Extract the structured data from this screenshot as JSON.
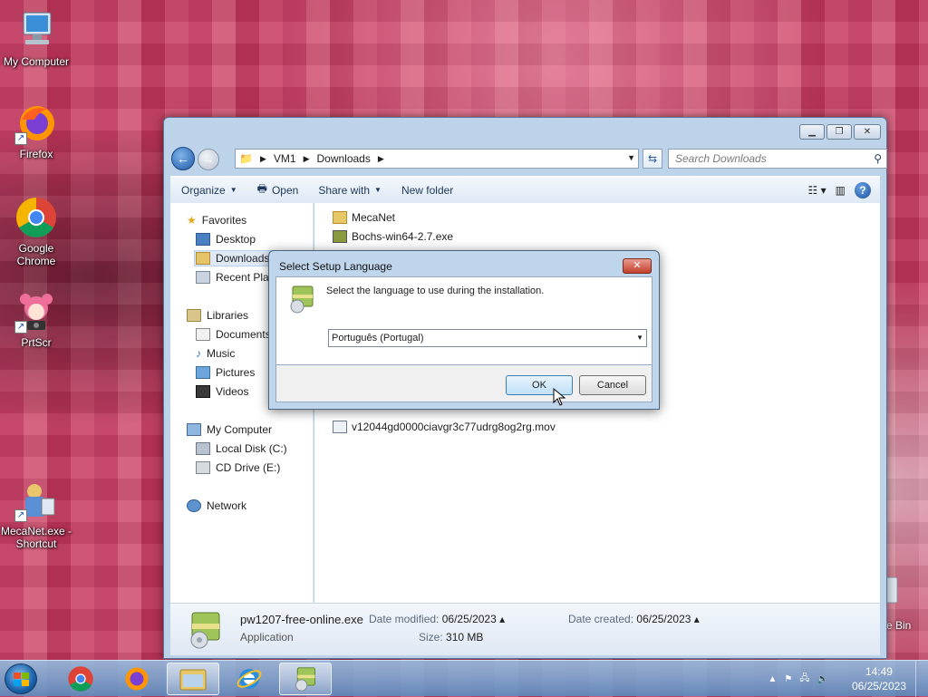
{
  "desktop": {
    "icons": [
      {
        "label": "My Computer"
      },
      {
        "label": "Firefox"
      },
      {
        "label": "Google Chrome"
      },
      {
        "label": "PrtScr"
      },
      {
        "label": "MecaNet.exe - Shortcut"
      }
    ],
    "recycle_partial": "e Bin"
  },
  "explorer": {
    "breadcrumb": [
      "VM1",
      "Downloads"
    ],
    "search_placeholder": "Search Downloads",
    "toolbar": {
      "organize": "Organize",
      "open": "Open",
      "share_with": "Share with",
      "new_folder": "New folder"
    },
    "nav": {
      "favorites": "Favorites",
      "desktop": "Desktop",
      "downloads": "Downloads",
      "recent": "Recent Plac",
      "libraries": "Libraries",
      "documents": "Documents",
      "music": "Music",
      "pictures": "Pictures",
      "videos": "Videos",
      "computer": "My Computer",
      "local_disk": "Local Disk (C:)",
      "cd_drive": "CD Drive (E:)",
      "network": "Network"
    },
    "files": [
      {
        "name": "MecaNet",
        "icon": "folder-icon"
      },
      {
        "name": "Bochs-win64-2.7.exe",
        "icon": "installer-icon"
      },
      {
        "name": "v12044gd0000ciavgr3c77udrg8og2rg.mov",
        "icon": "video-file-icon"
      }
    ],
    "details": {
      "filename": "pw1207-free-online.exe",
      "type": "Application",
      "date_modified_label": "Date modified:",
      "date_modified": "06/25/2023",
      "size_label": "Size:",
      "size": "310 MB",
      "date_created_label": "Date created:",
      "date_created": "06/25/2023"
    }
  },
  "dialog": {
    "title": "Select Setup Language",
    "message": "Select the language to use during the installation.",
    "selected_language": "Português (Portugal)",
    "ok": "OK",
    "cancel": "Cancel"
  },
  "taskbar": {
    "time": "14:49",
    "date": "06/25/2023"
  }
}
